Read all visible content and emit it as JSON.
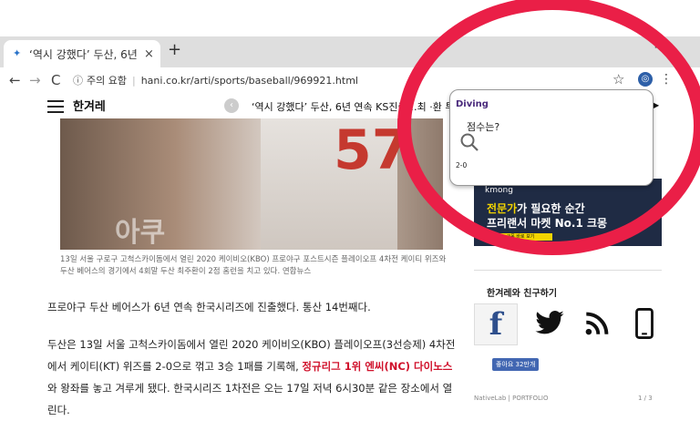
{
  "browser": {
    "tab_title": "‘역시 강했다’ 두산, 6년 연속",
    "tab_close": "×",
    "new_tab": "+",
    "window_min": "–",
    "back": "←",
    "forward": "→",
    "reload": "C",
    "security_note": "주의 요함",
    "url": "hani.co.kr/arti/sports/baseball/969921.html",
    "bookmark": "☆",
    "menu": "⋮"
  },
  "site": {
    "logo": "한겨레",
    "headline_ticker": "‘역시 강했다’ 두산, 6년 연속 KS진출…최 ·환 투런 ‘쾅",
    "prev_arrow": "‹",
    "next_arrow": "▶"
  },
  "article": {
    "photo_number": "57",
    "photo_overlay_text": "아쿠",
    "caption": "13일 서울 구로구 고척스카이돔에서 열린 2020 케이비오(KBO) 프로야구 포스트시즌 플레이오프 4차전 케이티 위즈와 두산 베어스의 경기에서 4회말 두산 최주환이 2점 홈런을 치고 있다. 연합뉴스",
    "para1": "프로야구 두산 베어스가 6년 연속 한국시리즈에 진출했다. 통산 14번째다.",
    "para2_pre": "두산은 13일 서울 고척스카이돔에서 열린 2020 케이비오(KBO) 플레이오프(3선승제) 4차전에서 케이티(KT) 위즈를 2-0으로 꺾고 3승 1패를 기록해, ",
    "para2_hl": "정규리그 1위 엔씨(NC) 다이노스",
    "para2_post": "와 왕좌를 놓고 겨루게 됐다. 한국시리즈 1차전은 오는 17일 저녁 6시30분 같은 장소에서 열린다."
  },
  "sidebar": {
    "ad_brand": "kmong",
    "ad_line1_highlight": "전문가",
    "ad_line1_rest": "가 필요한 순간",
    "ad_line2": "프리랜서 마켓 No.1 크몽",
    "ad_cta": "크몽 바로 보기",
    "friends_title": "한겨레와 친구하기",
    "facebook_glyph": "f",
    "like_label": "좋아요 32만개",
    "footer_left": "NativeLab | PORTFOLIO",
    "footer_right": "1 / 3"
  },
  "popup": {
    "title": "Diving",
    "question": "점수는?",
    "answer": "2-0"
  },
  "colors": {
    "annotation_ring": "#ea1f47",
    "headline_highlight": "#d0112b",
    "popup_title": "#4a2a7c"
  }
}
